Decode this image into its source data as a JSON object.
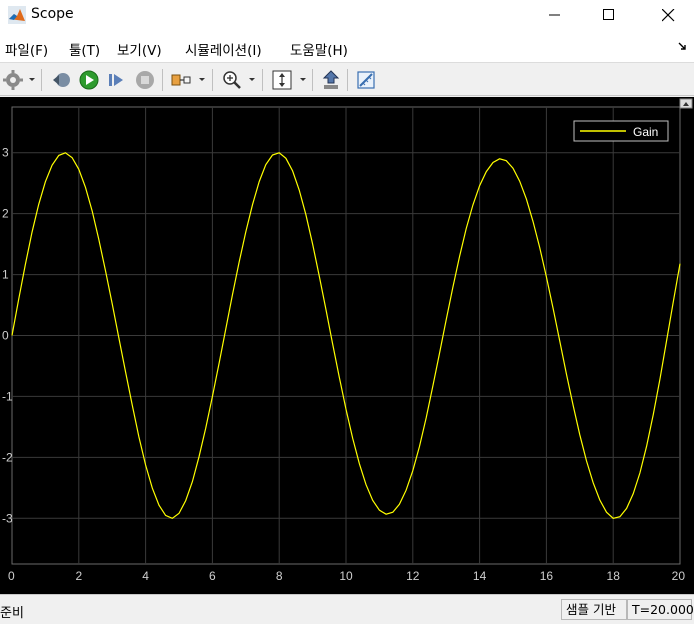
{
  "window": {
    "title": "Scope"
  },
  "menu": {
    "items": [
      "파일(F)",
      "툴(T)",
      "보기(V)",
      "시뮬레이션(I)",
      "도움말(H)"
    ]
  },
  "toolbar": {
    "icons": [
      "gear-icon",
      "step-back-icon",
      "run-icon",
      "step-forward-icon",
      "stop-icon",
      "signal-select-icon",
      "zoom-icon",
      "autoscale-icon",
      "highlight-block-icon",
      "measure-icon"
    ]
  },
  "status": {
    "ready": "준비",
    "mode": "샘플 기반",
    "time": "T=20.000"
  },
  "chart_data": {
    "type": "line",
    "title": "",
    "xlabel": "",
    "ylabel": "",
    "xlim": [
      0,
      20
    ],
    "ylim": [
      -3.75,
      3.75
    ],
    "xticks": [
      "0",
      "2",
      "4",
      "6",
      "8",
      "10",
      "12",
      "14",
      "16",
      "18",
      "20"
    ],
    "yticks": [
      "3",
      "2",
      "1",
      "0",
      "-1",
      "-2",
      "-3"
    ],
    "grid": true,
    "legend": "top-right",
    "series": [
      {
        "name": "Gain",
        "color": "#ffff00",
        "x": [
          0,
          0.2,
          0.4,
          0.6,
          0.8,
          1.0,
          1.2,
          1.4,
          1.6,
          1.8,
          2.0,
          2.2,
          2.4,
          2.6,
          2.8,
          3.0,
          3.2,
          3.4,
          3.6,
          3.8,
          4.0,
          4.2,
          4.4,
          4.6,
          4.8,
          5.0,
          5.2,
          5.4,
          5.6,
          5.8,
          6.0,
          6.2,
          6.4,
          6.6,
          6.8,
          7.0,
          7.2,
          7.4,
          7.6,
          7.8,
          8.0,
          8.2,
          8.4,
          8.6,
          8.8,
          9.0,
          9.2,
          9.4,
          9.6,
          9.8,
          10.0,
          10.2,
          10.4,
          10.6,
          10.8,
          11.0,
          11.2,
          11.4,
          11.6,
          11.8,
          12.0,
          12.2,
          12.4,
          12.6,
          12.8,
          13.0,
          13.2,
          13.4,
          13.6,
          13.8,
          14.0,
          14.2,
          14.4,
          14.6,
          14.8,
          15.0,
          15.2,
          15.4,
          15.6,
          15.8,
          16.0,
          16.2,
          16.4,
          16.6,
          16.8,
          17.0,
          17.2,
          17.4,
          17.6,
          17.8,
          18.0,
          18.2,
          18.4,
          18.6,
          18.8,
          19.0,
          19.2,
          19.4,
          19.6,
          19.8,
          20.0
        ],
        "y": [
          0.0,
          0.596,
          1.168,
          1.694,
          2.152,
          2.524,
          2.796,
          2.956,
          2.999,
          2.92,
          2.728,
          2.43,
          2.041,
          1.577,
          1.062,
          0.52,
          -0.042,
          -0.601,
          -1.139,
          -1.664,
          -2.125,
          -2.504,
          -2.785,
          -2.952,
          -3.0,
          -2.919,
          -2.71,
          -2.397,
          -1.991,
          -1.523,
          -1.001,
          -0.455,
          0.108,
          0.665,
          1.201,
          1.7,
          2.147,
          2.525,
          2.805,
          2.963,
          2.998,
          2.908,
          2.701,
          2.388,
          1.982,
          1.502,
          0.974,
          0.424,
          -0.134,
          -0.685,
          -1.21,
          -1.688,
          -2.105,
          -2.447,
          -2.704,
          -2.867,
          -2.932,
          -2.9,
          -2.77,
          -2.539,
          -2.218,
          -1.82,
          -1.35,
          -0.834,
          -0.293,
          0.259,
          0.795,
          1.3,
          1.754,
          2.141,
          2.458,
          2.69,
          2.839,
          2.9,
          2.869,
          2.745,
          2.532,
          2.239,
          1.872,
          1.444,
          0.962,
          0.444,
          -0.096,
          -0.63,
          -1.146,
          -1.629,
          -2.058,
          -2.418,
          -2.699,
          -2.9,
          -3.0,
          -2.973,
          -2.838,
          -2.598,
          -2.256,
          -1.816,
          -1.295,
          -0.71,
          -0.084,
          0.555,
          1.178
        ]
      }
    ]
  }
}
